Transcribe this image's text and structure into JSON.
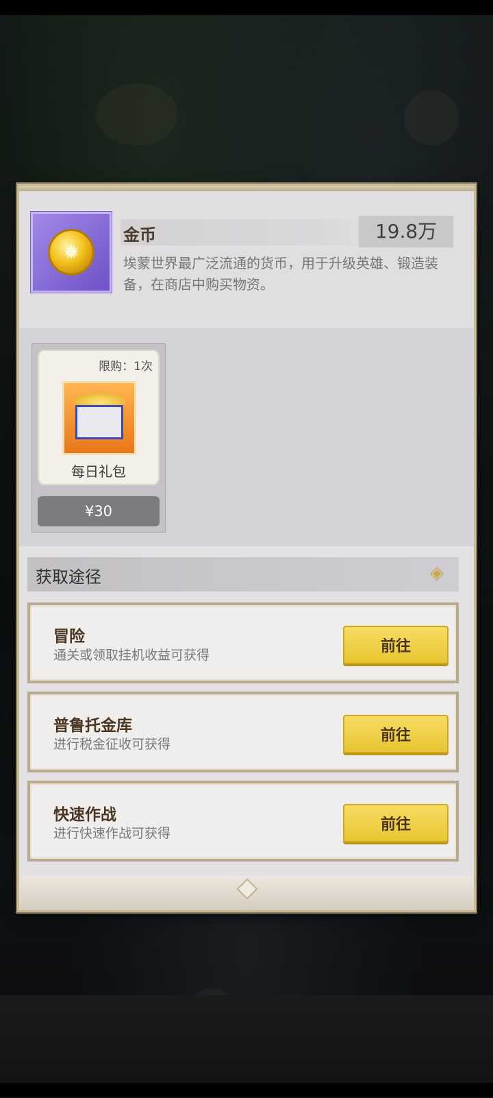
{
  "item": {
    "name": "金币",
    "count": "19.8万",
    "description": "埃蒙世界最广泛流通的货币，用于升级英雄、锻造装备，在商店中购买物资。"
  },
  "pack": {
    "limit": "限购：1次",
    "name": "每日礼包",
    "price": "¥30"
  },
  "ways": {
    "title": "获取途径",
    "entries": [
      {
        "name": "冒险",
        "desc": "通关或领取挂机收益可获得",
        "button": "前往"
      },
      {
        "name": "普鲁托金库",
        "desc": "进行税金征收可获得",
        "button": "前往"
      },
      {
        "name": "快速作战",
        "desc": "进行快速作战可获得",
        "button": "前往"
      }
    ]
  },
  "icons": {
    "currency": "gold-coin-icon",
    "pack": "treasure-chest-icon",
    "ways": "diamond-ornament-icon"
  },
  "colors": {
    "button": "#f0cf48",
    "item_frame": "#8c70da",
    "panel": "#e3e1e3"
  }
}
